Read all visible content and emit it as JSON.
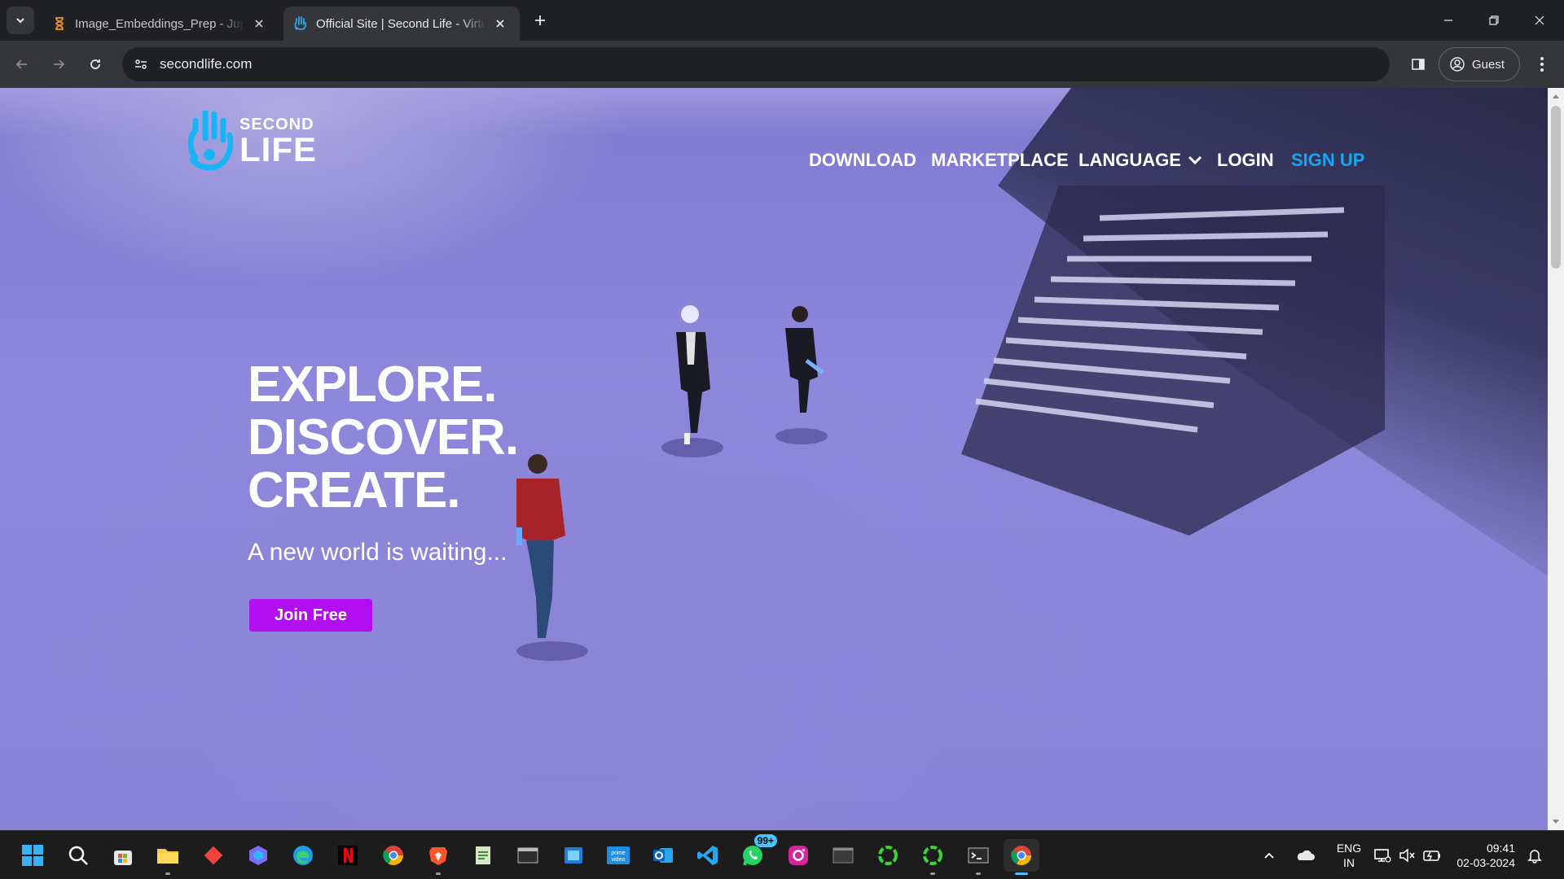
{
  "browser": {
    "tabs": [
      {
        "title": "Image_Embeddings_Prep - Jupyter",
        "active": false
      },
      {
        "title": "Official Site | Second Life - Virtual Worlds",
        "active": true
      }
    ],
    "url": "secondlife.com",
    "profile_label": "Guest"
  },
  "site": {
    "logo": {
      "line1": "SECOND",
      "line2": "LIFE"
    },
    "nav": {
      "download": "DOWNLOAD",
      "marketplace": "MARKETPLACE",
      "language": "LANGUAGE",
      "login": "LOGIN",
      "signup": "SIGN UP"
    },
    "hero": {
      "line1": "EXPLORE.",
      "line2": "DISCOVER.",
      "line3": "CREATE.",
      "subtitle": "A new world is waiting...",
      "cta": "Join Free"
    },
    "colors": {
      "signup": "#17a7f0",
      "cta": "#b10ff0"
    }
  },
  "taskbar": {
    "apps": [
      "windows-start-icon",
      "search-icon",
      "microsoft-store-icon",
      "file-explorer-icon",
      "anydesk-icon",
      "copilot-icon",
      "edge-icon",
      "netflix-icon",
      "chrome-icon",
      "brave-icon",
      "notepad-icon",
      "terminal-icon",
      "windows-app-icon",
      "prime-video-icon",
      "outlook-icon",
      "vscode-icon",
      "whatsapp-icon",
      "instagram-icon",
      "cmd-icon",
      "refresh-green-icon",
      "refresh-green-2-icon",
      "powershell-icon",
      "chrome-active-icon"
    ],
    "whatsapp_badge": "99+",
    "language": {
      "line1": "ENG",
      "line2": "IN"
    },
    "time": "09:41",
    "date": "02-03-2024"
  }
}
